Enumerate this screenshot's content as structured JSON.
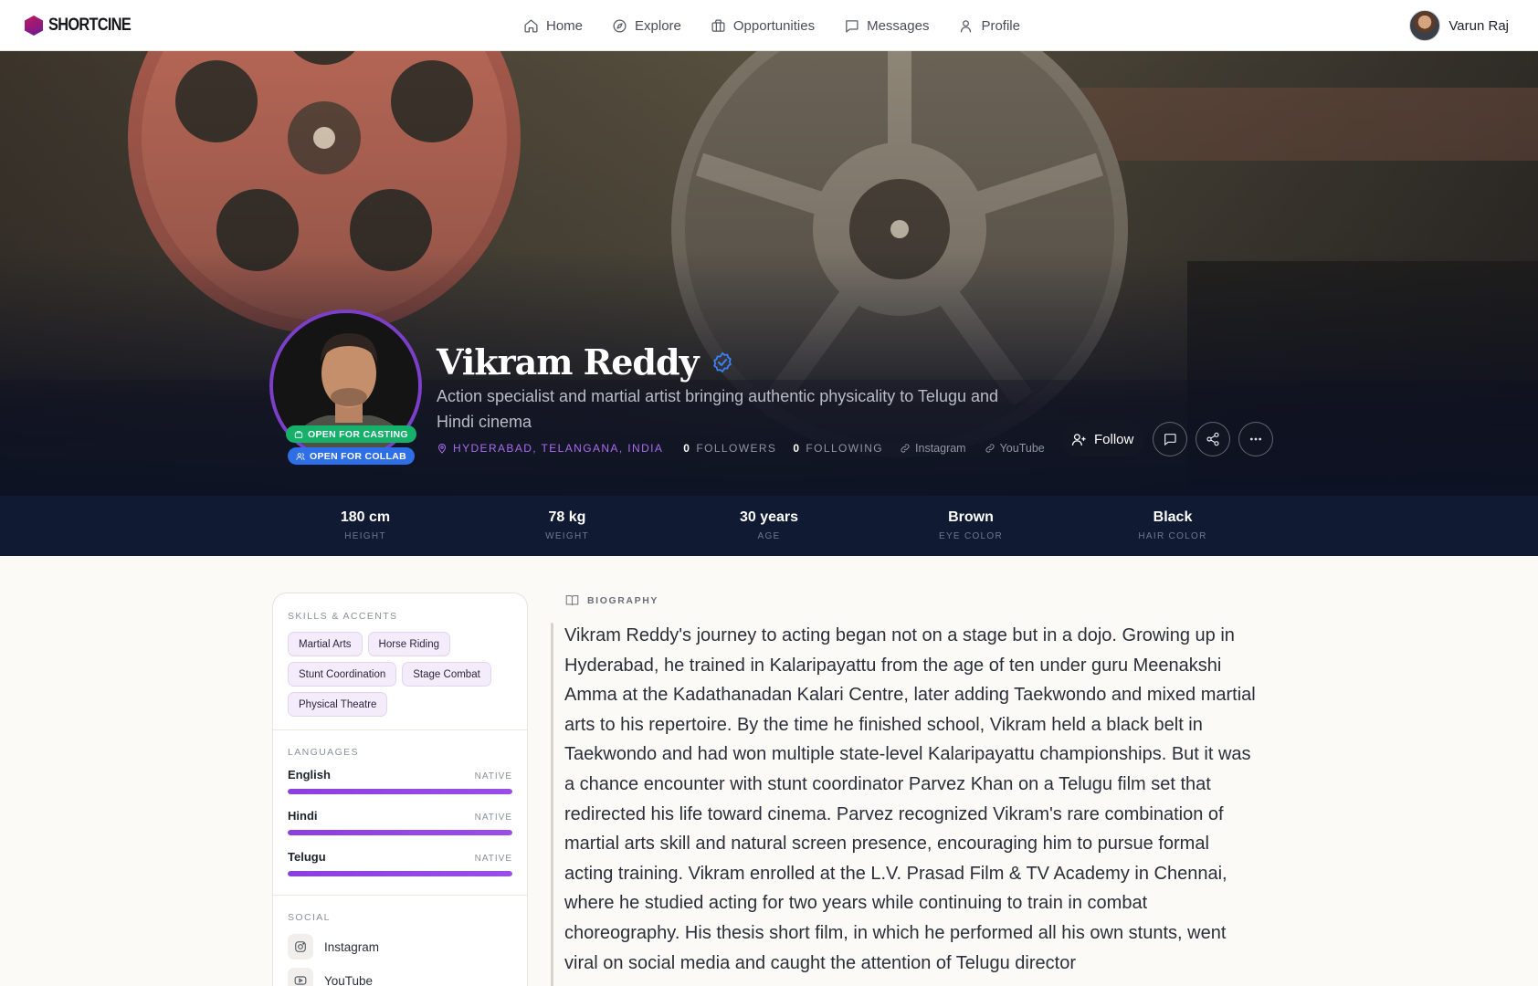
{
  "nav": {
    "logo": "SHORTCINE",
    "links": [
      {
        "label": "Home",
        "icon": "home-icon"
      },
      {
        "label": "Explore",
        "icon": "compass-icon"
      },
      {
        "label": "Opportunities",
        "icon": "briefcase-icon"
      },
      {
        "label": "Messages",
        "icon": "message-icon"
      },
      {
        "label": "Profile",
        "icon": "user-icon"
      }
    ],
    "user_name": "Varun Raj"
  },
  "profile": {
    "name": "Vikram Reddy",
    "verified": true,
    "tagline": "Action specialist and martial artist bringing authentic physicality to Telugu and Hindi cinema",
    "location": "HYDERABAD, TELANGANA, INDIA",
    "followers_count": "0",
    "followers_label": "FOLLOWERS",
    "following_count": "0",
    "following_label": "FOLLOWING",
    "links": [
      "Instagram",
      "YouTube"
    ],
    "badges": {
      "casting": "OPEN FOR CASTING",
      "collab": "OPEN FOR COLLAB"
    },
    "follow_label": "Follow"
  },
  "stats": [
    {
      "value": "180 cm",
      "label": "HEIGHT"
    },
    {
      "value": "78 kg",
      "label": "WEIGHT"
    },
    {
      "value": "30 years",
      "label": "AGE"
    },
    {
      "value": "Brown",
      "label": "EYE COLOR"
    },
    {
      "value": "Black",
      "label": "HAIR COLOR"
    }
  ],
  "sidebar": {
    "skills_title": "SKILLS & ACCENTS",
    "skills": [
      "Martial Arts",
      "Horse Riding",
      "Stunt Coordination",
      "Stage Combat",
      "Physical Theatre"
    ],
    "languages_title": "LANGUAGES",
    "languages": [
      {
        "name": "English",
        "level": "NATIVE",
        "proficiency": 1.0
      },
      {
        "name": "Hindi",
        "level": "NATIVE",
        "proficiency": 1.0
      },
      {
        "name": "Telugu",
        "level": "NATIVE",
        "proficiency": 1.0
      }
    ],
    "social_title": "SOCIAL",
    "social": [
      {
        "label": "Instagram",
        "icon": "instagram-icon"
      },
      {
        "label": "YouTube",
        "icon": "youtube-icon"
      }
    ]
  },
  "biography": {
    "title": "BIOGRAPHY",
    "text": "Vikram Reddy's journey to acting began not on a stage but in a dojo. Growing up in Hyderabad, he trained in Kalaripayattu from the age of ten under guru Meenakshi Amma at the Kadathanadan Kalari Centre, later adding Taekwondo and mixed martial arts to his repertoire. By the time he finished school, Vikram held a black belt in Taekwondo and had won multiple state-level Kalaripayattu championships. But it was a chance encounter with stunt coordinator Parvez Khan on a Telugu film set that redirected his life toward cinema. Parvez recognized Vikram's rare combination of martial arts skill and natural screen presence, encouraging him to pursue formal acting training. Vikram enrolled at the L.V. Prasad Film & TV Academy in Chennai, where he studied acting for two years while continuing to train in combat choreography. His thesis short film, in which he performed all his own stunts, went viral on social media and caught the attention of Telugu director"
  },
  "colors": {
    "accent": "#8b3fe0",
    "casting_badge": "#17b06b",
    "collab_badge": "#2f6fe6",
    "stats_bar": "#101a33"
  }
}
